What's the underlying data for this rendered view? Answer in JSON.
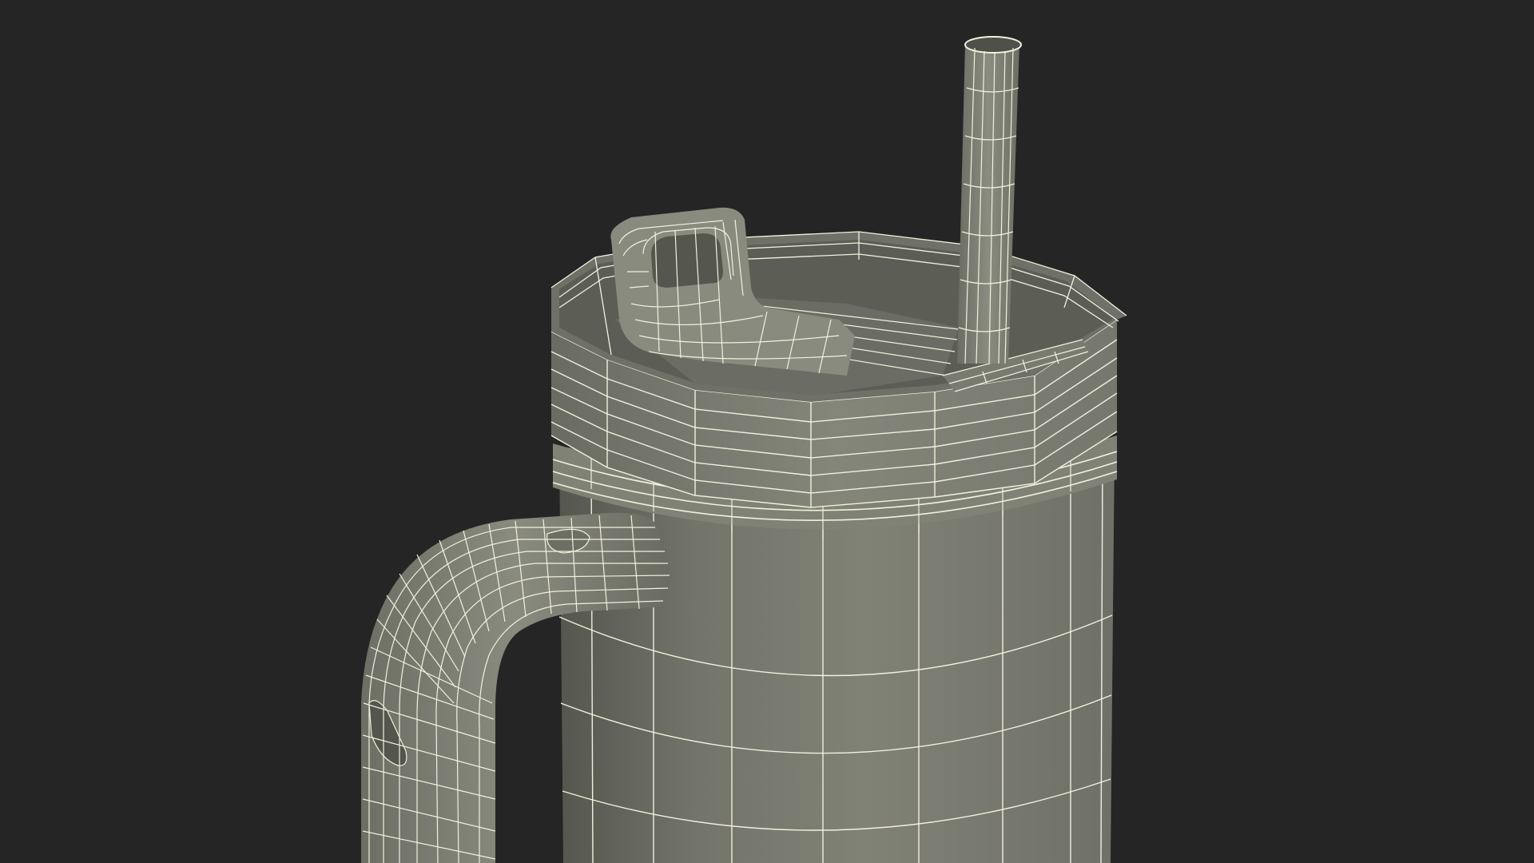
{
  "scene": {
    "subject": "tumbler-with-handle-and-straw",
    "render_style": "wireframe-over-clay",
    "colors": {
      "background": "#252525",
      "surface": "#7e7f73",
      "surface_shadow": "#5d5e55",
      "surface_dark": "#4f5049",
      "wire": "#f1f1dc"
    }
  }
}
